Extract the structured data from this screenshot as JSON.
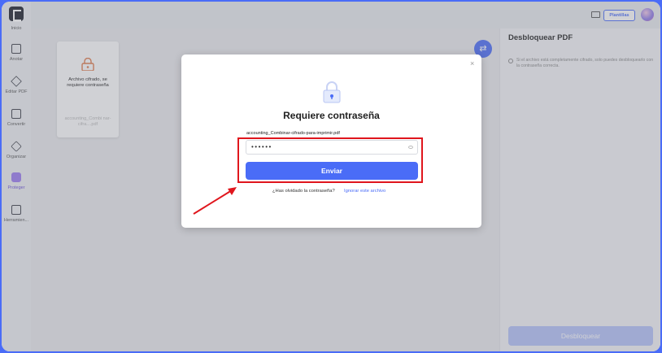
{
  "sidebar": {
    "items": [
      {
        "label": "Inicio"
      },
      {
        "label": "Anotar"
      },
      {
        "label": "Editar PDF"
      },
      {
        "label": "Convertir"
      },
      {
        "label": "Organizar"
      },
      {
        "label": "Proteger"
      },
      {
        "label": "Herramien..."
      }
    ]
  },
  "topbar": {
    "plantillas": "Plantillas"
  },
  "file_card": {
    "caption": "Archivo cifrado, se requiere contraseña",
    "filename": "accounting_Combi nar-cifra....pdf"
  },
  "right_panel": {
    "title": "Desbloquear PDF",
    "info": "Si el archivo está completamente cifrado, solo puedes desbloquearlo con la contraseña correcta.",
    "unlock_button": "Desbloquear"
  },
  "modal": {
    "title": "Requiere contraseña",
    "file_label": "accounting_Combinar-cifrado-para-imprimir.pdf",
    "password_value": "••••••",
    "submit": "Enviar",
    "forgot": "¿Has olvidado la contraseña?",
    "ignore": "Ignorar este archivo",
    "close": "×"
  },
  "colors": {
    "accent": "#4a6cf7",
    "highlight": "#e0161d"
  }
}
